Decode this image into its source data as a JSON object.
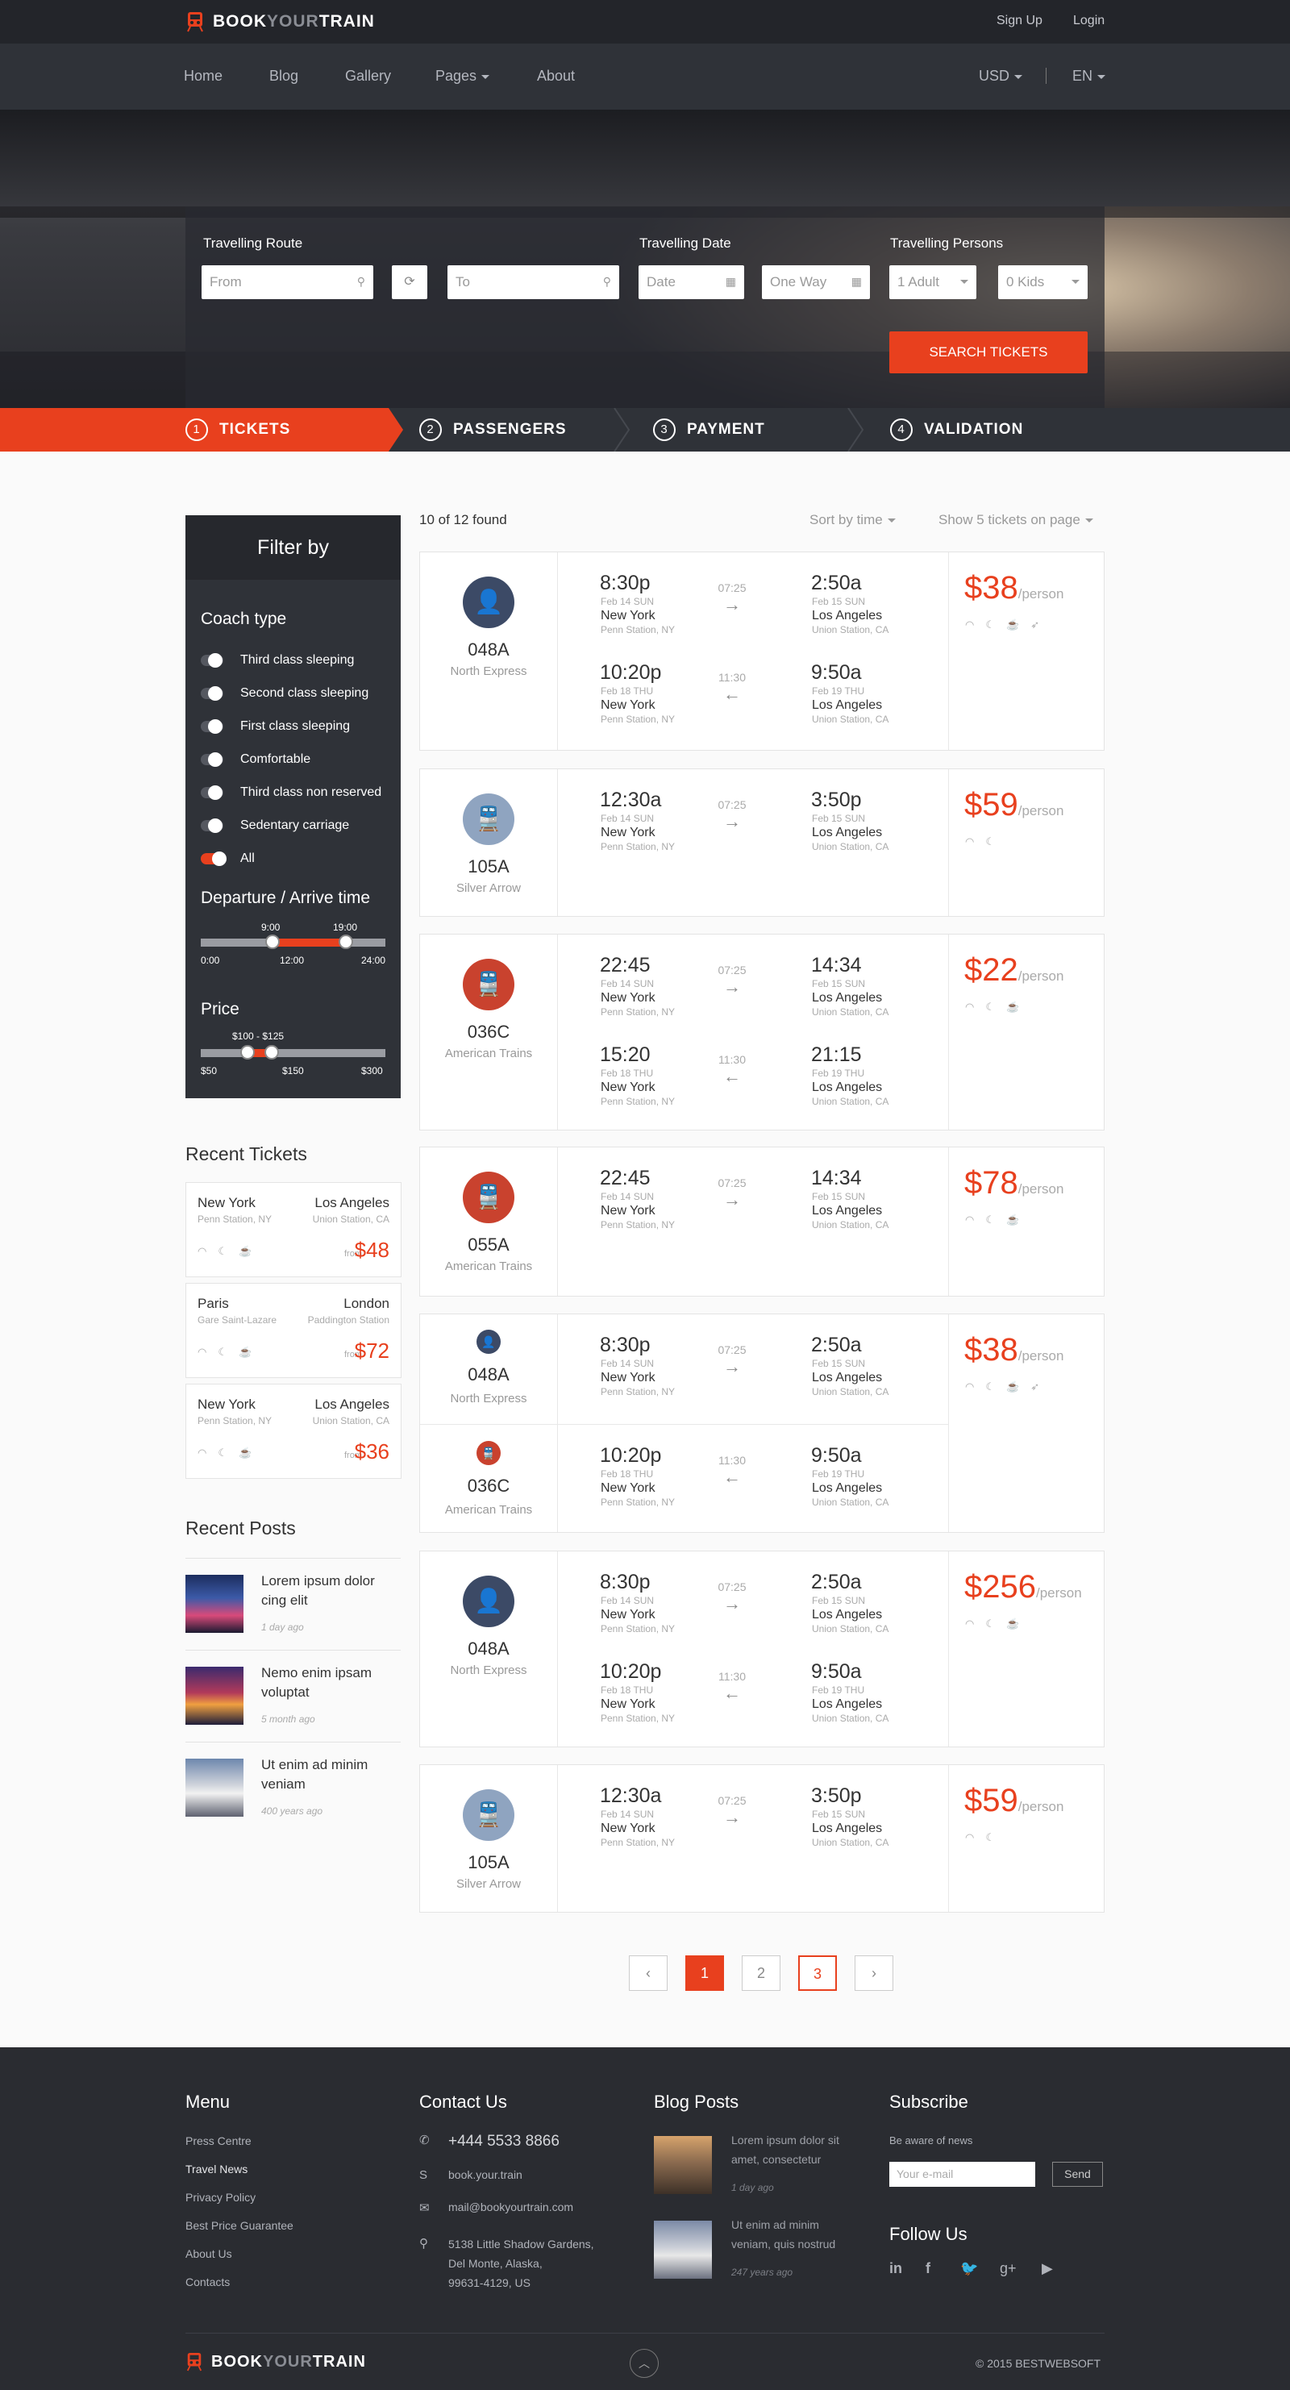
{
  "brand": {
    "part1": "BOOK",
    "part2": "YOUR",
    "part3": "TRAIN"
  },
  "topbar": {
    "signup": "Sign Up",
    "login": "Login"
  },
  "nav": {
    "items": [
      "Home",
      "Blog",
      "Gallery",
      "Pages",
      "About"
    ],
    "currency": "USD",
    "language": "EN"
  },
  "search": {
    "route_label": "Travelling Route",
    "from_placeholder": "From",
    "to_placeholder": "To",
    "date_label": "Travelling Date",
    "date_placeholder": "Date",
    "return_placeholder": "One Way",
    "persons_label": "Travelling Persons",
    "adults": "1 Adult",
    "kids": "0 Kids",
    "button": "SEARCH TICKETS"
  },
  "steps": [
    {
      "num": "1",
      "label": "TICKETS"
    },
    {
      "num": "2",
      "label": "PASSENGERS"
    },
    {
      "num": "3",
      "label": "PAYMENT"
    },
    {
      "num": "4",
      "label": "VALIDATION"
    }
  ],
  "filter": {
    "title": "Filter by",
    "coach_title": "Coach type",
    "coach_types": [
      {
        "label": "Third class sleeping",
        "on": false
      },
      {
        "label": "Second class sleeping",
        "on": false
      },
      {
        "label": "First class sleeping",
        "on": false
      },
      {
        "label": "Comfortable",
        "on": false
      },
      {
        "label": "Third class non reserved",
        "on": false
      },
      {
        "label": "Sedentary carriage",
        "on": false
      },
      {
        "label": "All",
        "on": true
      }
    ],
    "time_title": "Departure / Arrive time",
    "time_from": "9:00",
    "time_to": "19:00",
    "time_ticks": [
      "0:00",
      "12:00",
      "24:00"
    ],
    "price_title": "Price",
    "price_range": "$100 - $125",
    "price_ticks": [
      "$50",
      "$150",
      "$300"
    ]
  },
  "recent_tickets": {
    "title": "Recent Tickets",
    "items": [
      {
        "from": "New York",
        "from_station": "Penn Station, NY",
        "to": "Los Angeles",
        "to_station": "Union Station, CA",
        "from_label": "from",
        "price": "$48"
      },
      {
        "from": "Paris",
        "from_station": "Gare Saint-Lazare",
        "to": "London",
        "to_station": "Paddington Station",
        "from_label": "from",
        "price": "$72"
      },
      {
        "from": "New York",
        "from_station": "Penn Station, NY",
        "to": "Los Angeles",
        "to_station": "Union Station, CA",
        "from_label": "from",
        "price": "$36"
      }
    ]
  },
  "recent_posts": {
    "title": "Recent Posts",
    "items": [
      {
        "title": "Lorem ipsum dolor cing elit",
        "date": "1 day ago"
      },
      {
        "title": "Nemo enim ipsam voluptat",
        "date": "5 month ago"
      },
      {
        "title": "Ut enim ad minim veniam",
        "date": "400 years ago"
      }
    ]
  },
  "results": {
    "found": "10 of 12 found",
    "sort": "Sort by time",
    "show": "Show 5 tickets on page",
    "per_person": "/person",
    "cards": [
      {
        "code": "048A",
        "name": "North Express",
        "price": "$38",
        "legs": [
          {
            "dep": "8:30p",
            "dep_date": "Feb 14 SUN",
            "from": "New York",
            "from_sta": "Penn Station, NY",
            "dur": "07:25",
            "arr": "2:50a",
            "arr_date": "Feb 15 SUN",
            "to": "Los Angeles",
            "to_sta": "Union Station, CA",
            "dir": "→"
          },
          {
            "dep": "10:20p",
            "dep_date": "Feb 18 THU",
            "from": "New York",
            "from_sta": "Penn Station, NY",
            "dur": "11:30",
            "arr": "9:50a",
            "arr_date": "Feb 19 THU",
            "to": "Los Angeles",
            "to_sta": "Union Station, CA",
            "dir": "←"
          }
        ]
      },
      {
        "code": "105A",
        "name": "Silver Arrow",
        "price": "$59",
        "legs": [
          {
            "dep": "12:30a",
            "dep_date": "Feb 14 SUN",
            "from": "New York",
            "from_sta": "Penn Station, NY",
            "dur": "07:25",
            "arr": "3:50p",
            "arr_date": "Feb 15 SUN",
            "to": "Los Angeles",
            "to_sta": "Union Station, CA",
            "dir": "→"
          }
        ]
      },
      {
        "code": "036C",
        "name": "American Trains",
        "price": "$22",
        "legs": [
          {
            "dep": "22:45",
            "dep_date": "Feb 14 SUN",
            "from": "New York",
            "from_sta": "Penn Station, NY",
            "dur": "07:25",
            "arr": "14:34",
            "arr_date": "Feb 15 SUN",
            "to": "Los Angeles",
            "to_sta": "Union Station, CA",
            "dir": "→"
          },
          {
            "dep": "15:20",
            "dep_date": "Feb 18 THU",
            "from": "New York",
            "from_sta": "Penn Station, NY",
            "dur": "11:30",
            "arr": "21:15",
            "arr_date": "Feb 19 THU",
            "to": "Los Angeles",
            "to_sta": "Union Station, CA",
            "dir": "←"
          }
        ]
      },
      {
        "code": "055A",
        "name": "American Trains",
        "price": "$78",
        "legs": [
          {
            "dep": "22:45",
            "dep_date": "Feb 14 SUN",
            "from": "New York",
            "from_sta": "Penn Station, NY",
            "dur": "07:25",
            "arr": "14:34",
            "arr_date": "Feb 15 SUN",
            "to": "Los Angeles",
            "to_sta": "Union Station, CA",
            "dir": "→"
          }
        ]
      },
      {
        "code": "048A",
        "name": "North Express",
        "code2": "036C",
        "name2": "American Trains",
        "price": "$38",
        "legs": [
          {
            "dep": "8:30p",
            "dep_date": "Feb 14 SUN",
            "from": "New York",
            "from_sta": "Penn Station, NY",
            "dur": "07:25",
            "arr": "2:50a",
            "arr_date": "Feb 15 SUN",
            "to": "Los Angeles",
            "to_sta": "Union Station, CA",
            "dir": "→"
          },
          {
            "dep": "10:20p",
            "dep_date": "Feb 18 THU",
            "from": "New York",
            "from_sta": "Penn Station, NY",
            "dur": "11:30",
            "arr": "9:50a",
            "arr_date": "Feb 19 THU",
            "to": "Los Angeles",
            "to_sta": "Union Station, CA",
            "dir": "←"
          }
        ]
      },
      {
        "code": "048A",
        "name": "North Express",
        "price": "$256",
        "legs": [
          {
            "dep": "8:30p",
            "dep_date": "Feb 14 SUN",
            "from": "New York",
            "from_sta": "Penn Station, NY",
            "dur": "07:25",
            "arr": "2:50a",
            "arr_date": "Feb 15 SUN",
            "to": "Los Angeles",
            "to_sta": "Union Station, CA",
            "dir": "→"
          },
          {
            "dep": "10:20p",
            "dep_date": "Feb 18 THU",
            "from": "New York",
            "from_sta": "Penn Station, NY",
            "dur": "11:30",
            "arr": "9:50a",
            "arr_date": "Feb 19 THU",
            "to": "Los Angeles",
            "to_sta": "Union Station, CA",
            "dir": "←"
          }
        ]
      },
      {
        "code": "105A",
        "name": "Silver Arrow",
        "price": "$59",
        "legs": [
          {
            "dep": "12:30a",
            "dep_date": "Feb 14 SUN",
            "from": "New York",
            "from_sta": "Penn Station, NY",
            "dur": "07:25",
            "arr": "3:50p",
            "arr_date": "Feb 15 SUN",
            "to": "Los Angeles",
            "to_sta": "Union Station, CA",
            "dir": "→"
          }
        ]
      }
    ]
  },
  "pagination": {
    "prev": "‹",
    "pages": [
      "1",
      "2",
      "3"
    ],
    "next": "›"
  },
  "footer": {
    "menu_title": "Menu",
    "menu": [
      "Press Centre",
      "Travel News",
      "Privacy Policy",
      "Best Price Guarantee",
      "About Us",
      "Contacts"
    ],
    "contact_title": "Contact Us",
    "phone": "+444 5533 8866",
    "skype": "book.your.train",
    "email": "mail@bookyourtrain.com",
    "address": [
      "5138 Little Shadow Gardens,",
      "Del Monte, Alaska,",
      "99631-4129, US"
    ],
    "blog_title": "Blog Posts",
    "blog": [
      {
        "title": "Lorem ipsum dolor sit amet, consectetur",
        "date": "1 day ago"
      },
      {
        "title": "Ut enim ad minim veniam, quis nostrud",
        "date": "247 years ago"
      }
    ],
    "subscribe_title": "Subscribe",
    "subscribe_text": "Be aware of news",
    "email_placeholder": "Your e-mail",
    "send": "Send",
    "follow_title": "Follow Us",
    "copyright": "© 2015 BESTWEBSOFT"
  },
  "colors": {
    "accent": "#e8401e",
    "dark": "#2f3238",
    "navy": "#3c4a66",
    "silver": "#8fa4c0",
    "red": "#c9422e"
  }
}
